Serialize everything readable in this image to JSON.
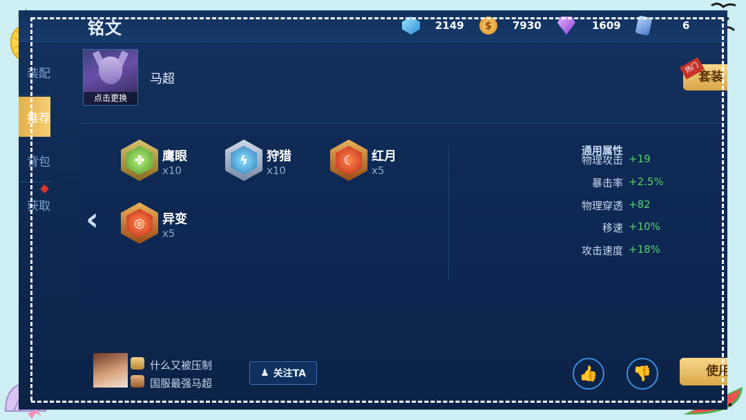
{
  "header": {
    "title": "铭文",
    "resources": [
      {
        "icon": "crystal-icon",
        "value": "2149"
      },
      {
        "icon": "coin-icon",
        "value": "7930"
      },
      {
        "icon": "diamond-icon",
        "value": "1609"
      },
      {
        "icon": "card-icon",
        "value": "6"
      }
    ]
  },
  "sidebar": {
    "items": [
      {
        "label": "装配",
        "active": false
      },
      {
        "label": "推荐",
        "active": true
      },
      {
        "label": "背包",
        "active": false
      },
      {
        "label": "获取",
        "active": false
      }
    ]
  },
  "hero": {
    "change_label": "点击更换",
    "name": "马超"
  },
  "set_button": {
    "hot_label": "热门",
    "label": "套装"
  },
  "runes": [
    {
      "name": "鹰眼",
      "count": "x10",
      "color": "green"
    },
    {
      "name": "狩猎",
      "count": "x10",
      "color": "blue"
    },
    {
      "name": "红月",
      "count": "x5",
      "color": "red"
    },
    {
      "name": "异变",
      "count": "x5",
      "color": "red"
    }
  ],
  "attributes": {
    "title": "通用属性",
    "rows": [
      {
        "name": "物理攻击",
        "value": "+19"
      },
      {
        "name": "暴击率",
        "value": "+2.5%"
      },
      {
        "name": "物理穿透",
        "value": "+82"
      },
      {
        "name": "移速",
        "value": "+10%"
      },
      {
        "name": "攻击速度",
        "value": "+18%"
      }
    ]
  },
  "author": {
    "line1": "什么又被压制",
    "line2": "国服最强马超",
    "follow_label": "关注TA"
  },
  "actions": {
    "use_label": "使用"
  },
  "colors": {
    "accent_gold": "#e3b04a",
    "positive_green": "#56d36b",
    "panel_blue": "#0f2b56"
  }
}
